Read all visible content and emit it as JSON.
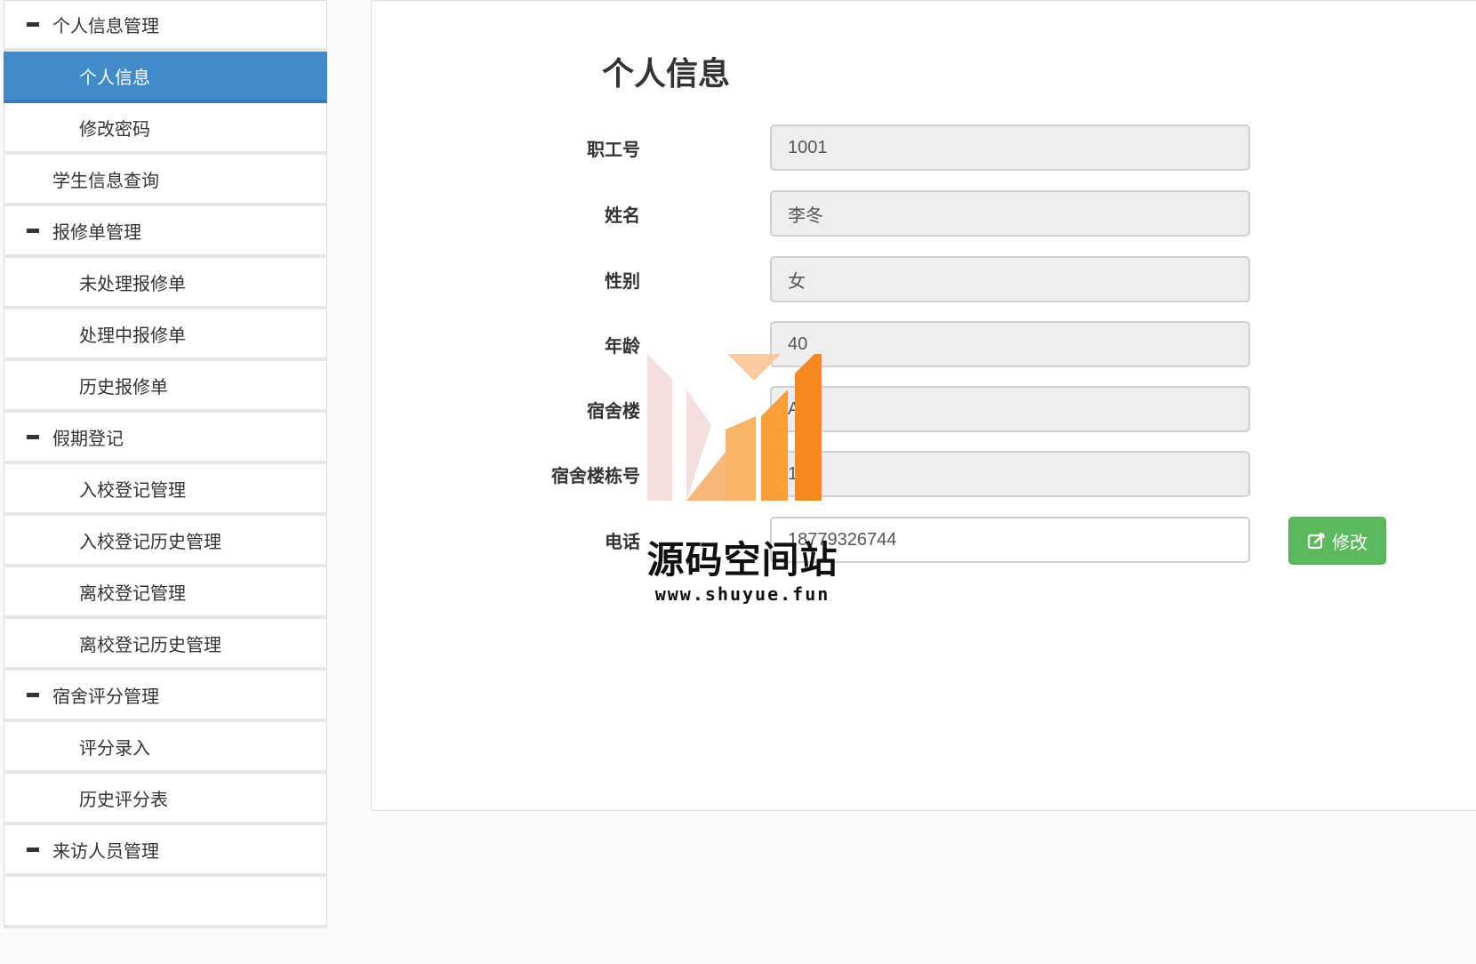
{
  "sidebar": {
    "items": [
      {
        "label": "个人信息管理",
        "kind": "header"
      },
      {
        "label": "个人信息",
        "kind": "child",
        "active": true
      },
      {
        "label": "修改密码",
        "kind": "child"
      },
      {
        "label": "学生信息查询",
        "kind": "top"
      },
      {
        "label": "报修单管理",
        "kind": "header"
      },
      {
        "label": "未处理报修单",
        "kind": "child"
      },
      {
        "label": "处理中报修单",
        "kind": "child"
      },
      {
        "label": "历史报修单",
        "kind": "child"
      },
      {
        "label": "假期登记",
        "kind": "header"
      },
      {
        "label": "入校登记管理",
        "kind": "child"
      },
      {
        "label": "入校登记历史管理",
        "kind": "child"
      },
      {
        "label": "离校登记管理",
        "kind": "child"
      },
      {
        "label": "离校登记历史管理",
        "kind": "child"
      },
      {
        "label": "宿舍评分管理",
        "kind": "header"
      },
      {
        "label": "评分录入",
        "kind": "child"
      },
      {
        "label": "历史评分表",
        "kind": "child"
      },
      {
        "label": "来访人员管理",
        "kind": "header"
      }
    ]
  },
  "main": {
    "title": "个人信息",
    "fields": [
      {
        "label": "职工号",
        "value": "1001"
      },
      {
        "label": "姓名",
        "value": "李冬"
      },
      {
        "label": "性别",
        "value": "女"
      },
      {
        "label": "年龄",
        "value": "40"
      },
      {
        "label": "宿舍楼",
        "value": "A"
      },
      {
        "label": "宿舍楼栋号",
        "value": "1"
      },
      {
        "label": "电话",
        "value": "18779326744"
      }
    ],
    "edit_button": "修改",
    "edit_icon": "edit-icon"
  },
  "watermark": {
    "text": "源码空间站",
    "url": "www.shuyue.fun"
  },
  "colors": {
    "active": "#428bca",
    "success": "#5cb85c",
    "watermark_orange": "#f5891f"
  }
}
